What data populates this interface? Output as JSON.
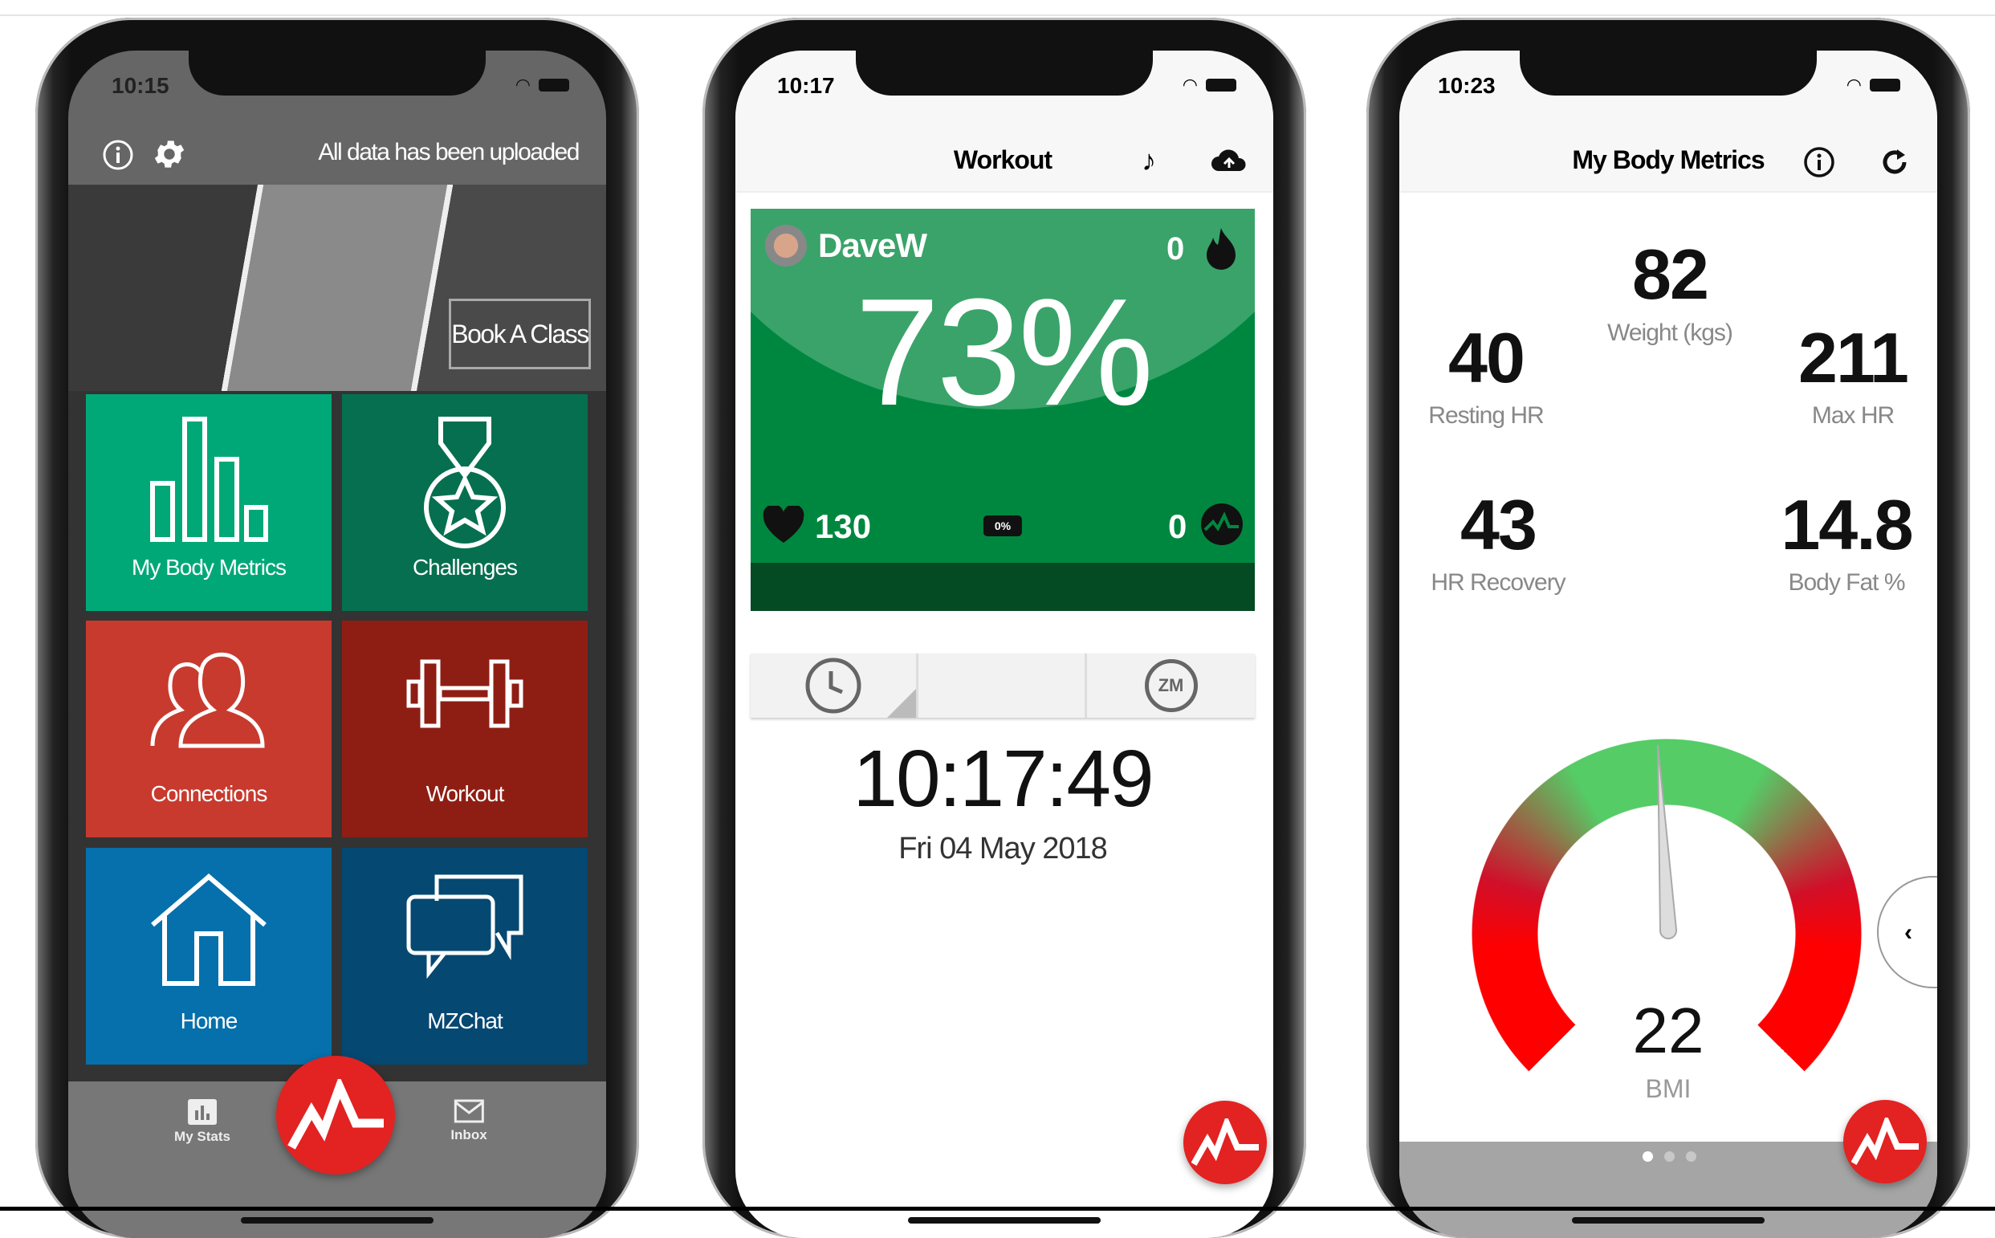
{
  "colors": {
    "teal": "#00a878",
    "dark_green": "#066f4f",
    "red": "#c83a2e",
    "dark_red": "#8e1e14",
    "blue": "#0570ab",
    "navy": "#054872",
    "brand_red": "#e32222",
    "card_green": "#00873f"
  },
  "phone1": {
    "status_time": "10:15",
    "header_status": "All data has been uploaded",
    "icons": [
      "info-icon",
      "gear-icon"
    ],
    "banner_button": "Book A Class",
    "tiles": [
      {
        "label": "My Body Metrics",
        "icon": "bar-chart-icon"
      },
      {
        "label": "Challenges",
        "icon": "medal-icon"
      },
      {
        "label": "Connections",
        "icon": "users-icon"
      },
      {
        "label": "Workout",
        "icon": "dumbbell-icon"
      },
      {
        "label": "Home",
        "icon": "house-icon"
      },
      {
        "label": "MZChat",
        "icon": "chat-icon"
      }
    ],
    "tabbar": {
      "left": "My Stats",
      "right": "Inbox"
    }
  },
  "phone2": {
    "status_time": "10:17",
    "title": "Workout",
    "card": {
      "user": "DaveW",
      "calories": "0",
      "effort_percent": "73%",
      "heart_rate": "130",
      "battery": "0%",
      "points": "0"
    },
    "clock": {
      "time": "10:17:49",
      "date": "Fri 04 May 2018"
    },
    "segment_right": "ZM"
  },
  "phone3": {
    "status_time": "10:23",
    "title": "My Body Metrics",
    "metrics": {
      "weight": {
        "value": "82",
        "label": "Weight (kgs)"
      },
      "resting_hr": {
        "value": "40",
        "label": "Resting HR"
      },
      "max_hr": {
        "value": "211",
        "label": "Max HR"
      },
      "hr_recovery": {
        "value": "43",
        "label": "HR Recovery"
      },
      "body_fat": {
        "value": "14.8",
        "label": "Body Fat %"
      }
    },
    "gauge": {
      "value": "22",
      "label": "BMI"
    },
    "page_indicator": {
      "pages": 3,
      "active": 1
    }
  }
}
